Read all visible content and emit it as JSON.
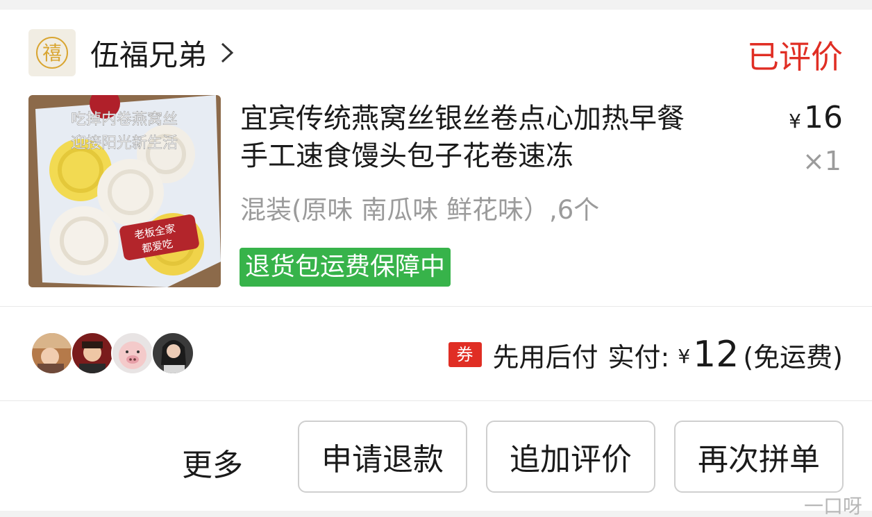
{
  "shop": {
    "name": "伍福兄弟",
    "logo_glyph": "禧"
  },
  "order": {
    "status": "已评价"
  },
  "product": {
    "title_line1": "宜宾传统燕窝丝银丝卷点心加热早餐",
    "title_line2": "手工速食馒头包子花卷速冻",
    "price_symbol": "¥",
    "price": "16",
    "quantity": "×1",
    "spec": "混装(原味  南瓜味  鲜花味）,6个",
    "badge": "退货包运费保障中",
    "image_caption_line1": "吃掉内卷燕窝丝",
    "image_caption_line2": "迎接阳光新生活",
    "image_sticker_line1": "老板全家",
    "image_sticker_line2": "都爱吃"
  },
  "payment": {
    "coupon_label": "券",
    "method": "先用后付",
    "paid_label": "实付:",
    "currency": "¥",
    "amount": "12",
    "shipping": "(免运费)"
  },
  "actions": {
    "more": "更多",
    "refund": "申请退款",
    "add_review": "追加评价",
    "reorder": "再次拼单"
  },
  "watermark": "一口呀",
  "colors": {
    "accent_red": "#e02e24",
    "badge_green": "#37b34a",
    "muted_gray": "#9b9b9b"
  }
}
